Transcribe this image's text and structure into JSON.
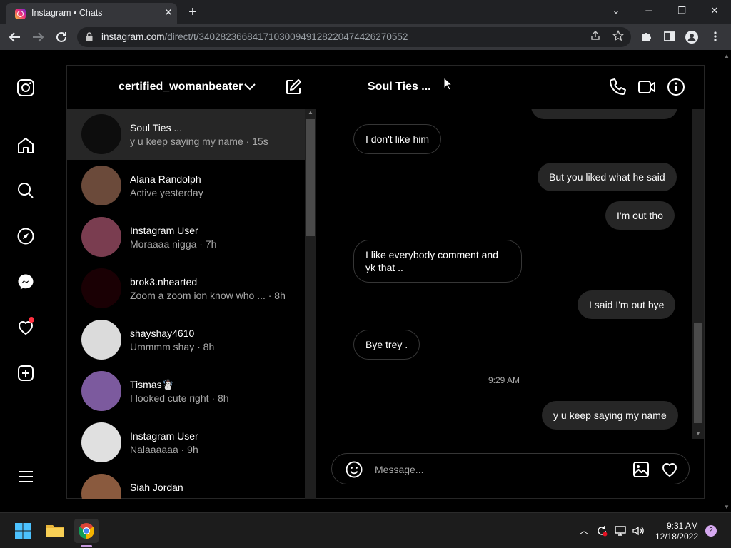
{
  "browser": {
    "tab_title": "Instagram • Chats",
    "tab_close": "✕",
    "new_tab": "+",
    "url_host": "instagram.com",
    "url_path": "/direct/t/340282366841710300949128220474426270552",
    "window_minimize": "─",
    "window_restore": "❐",
    "window_close": "✕",
    "tab_search": "⌄"
  },
  "dm_list": {
    "account_name": "certified_womanbeater",
    "threads": [
      {
        "name": "Soul Ties ...",
        "sub": "y u keep saying my name · 15s",
        "active": true,
        "color": "#0d0d0d"
      },
      {
        "name": "Alana Randolph",
        "sub": "Active yesterday",
        "color": "#6b4a3a"
      },
      {
        "name": "Instagram User",
        "sub": "Moraaaa nigga · 7h",
        "color": "#7a3d50"
      },
      {
        "name": "brok3.nhearted",
        "sub": "Zoom a zoom ion know who ...  · 8h",
        "color": "#1a0004"
      },
      {
        "name": "shayshay4610",
        "sub": "Ummmm shay · 8h",
        "color": "#dbdbdb"
      },
      {
        "name": "Tismas☃️",
        "sub": "I looked cute right · 8h",
        "color": "#7c5a9e"
      },
      {
        "name": "Instagram User",
        "sub": "Nalaaaaaa · 9h",
        "color": "#e0e0e0"
      },
      {
        "name": "Siah Jordan",
        "sub": "",
        "color": "#8a5a3e"
      }
    ]
  },
  "chat": {
    "title": "Soul Ties ...",
    "messages": [
      {
        "text": "I don't like him",
        "dir": "in"
      },
      {
        "text": "But you liked what he said",
        "dir": "out"
      },
      {
        "text": "I'm out tho",
        "dir": "out"
      },
      {
        "text": "I like everybody comment and yk that ..",
        "dir": "in"
      },
      {
        "text": "I said I'm out bye",
        "dir": "out"
      },
      {
        "text": "Bye trey .",
        "dir": "in"
      },
      {
        "text": "y u keep saying my name",
        "dir": "out"
      }
    ],
    "timestamp": "9:29 AM",
    "composer_placeholder": "Message..."
  },
  "taskbar": {
    "time": "9:31 AM",
    "date": "12/18/2022",
    "notification_count": "2",
    "tray_chevron": "︿"
  },
  "colors": {
    "background": "#000000",
    "outgoing_bubble": "#262626",
    "incoming_border": "#363636",
    "secondary_text": "#a8a8a8",
    "notification_dot": "#ff3040"
  }
}
